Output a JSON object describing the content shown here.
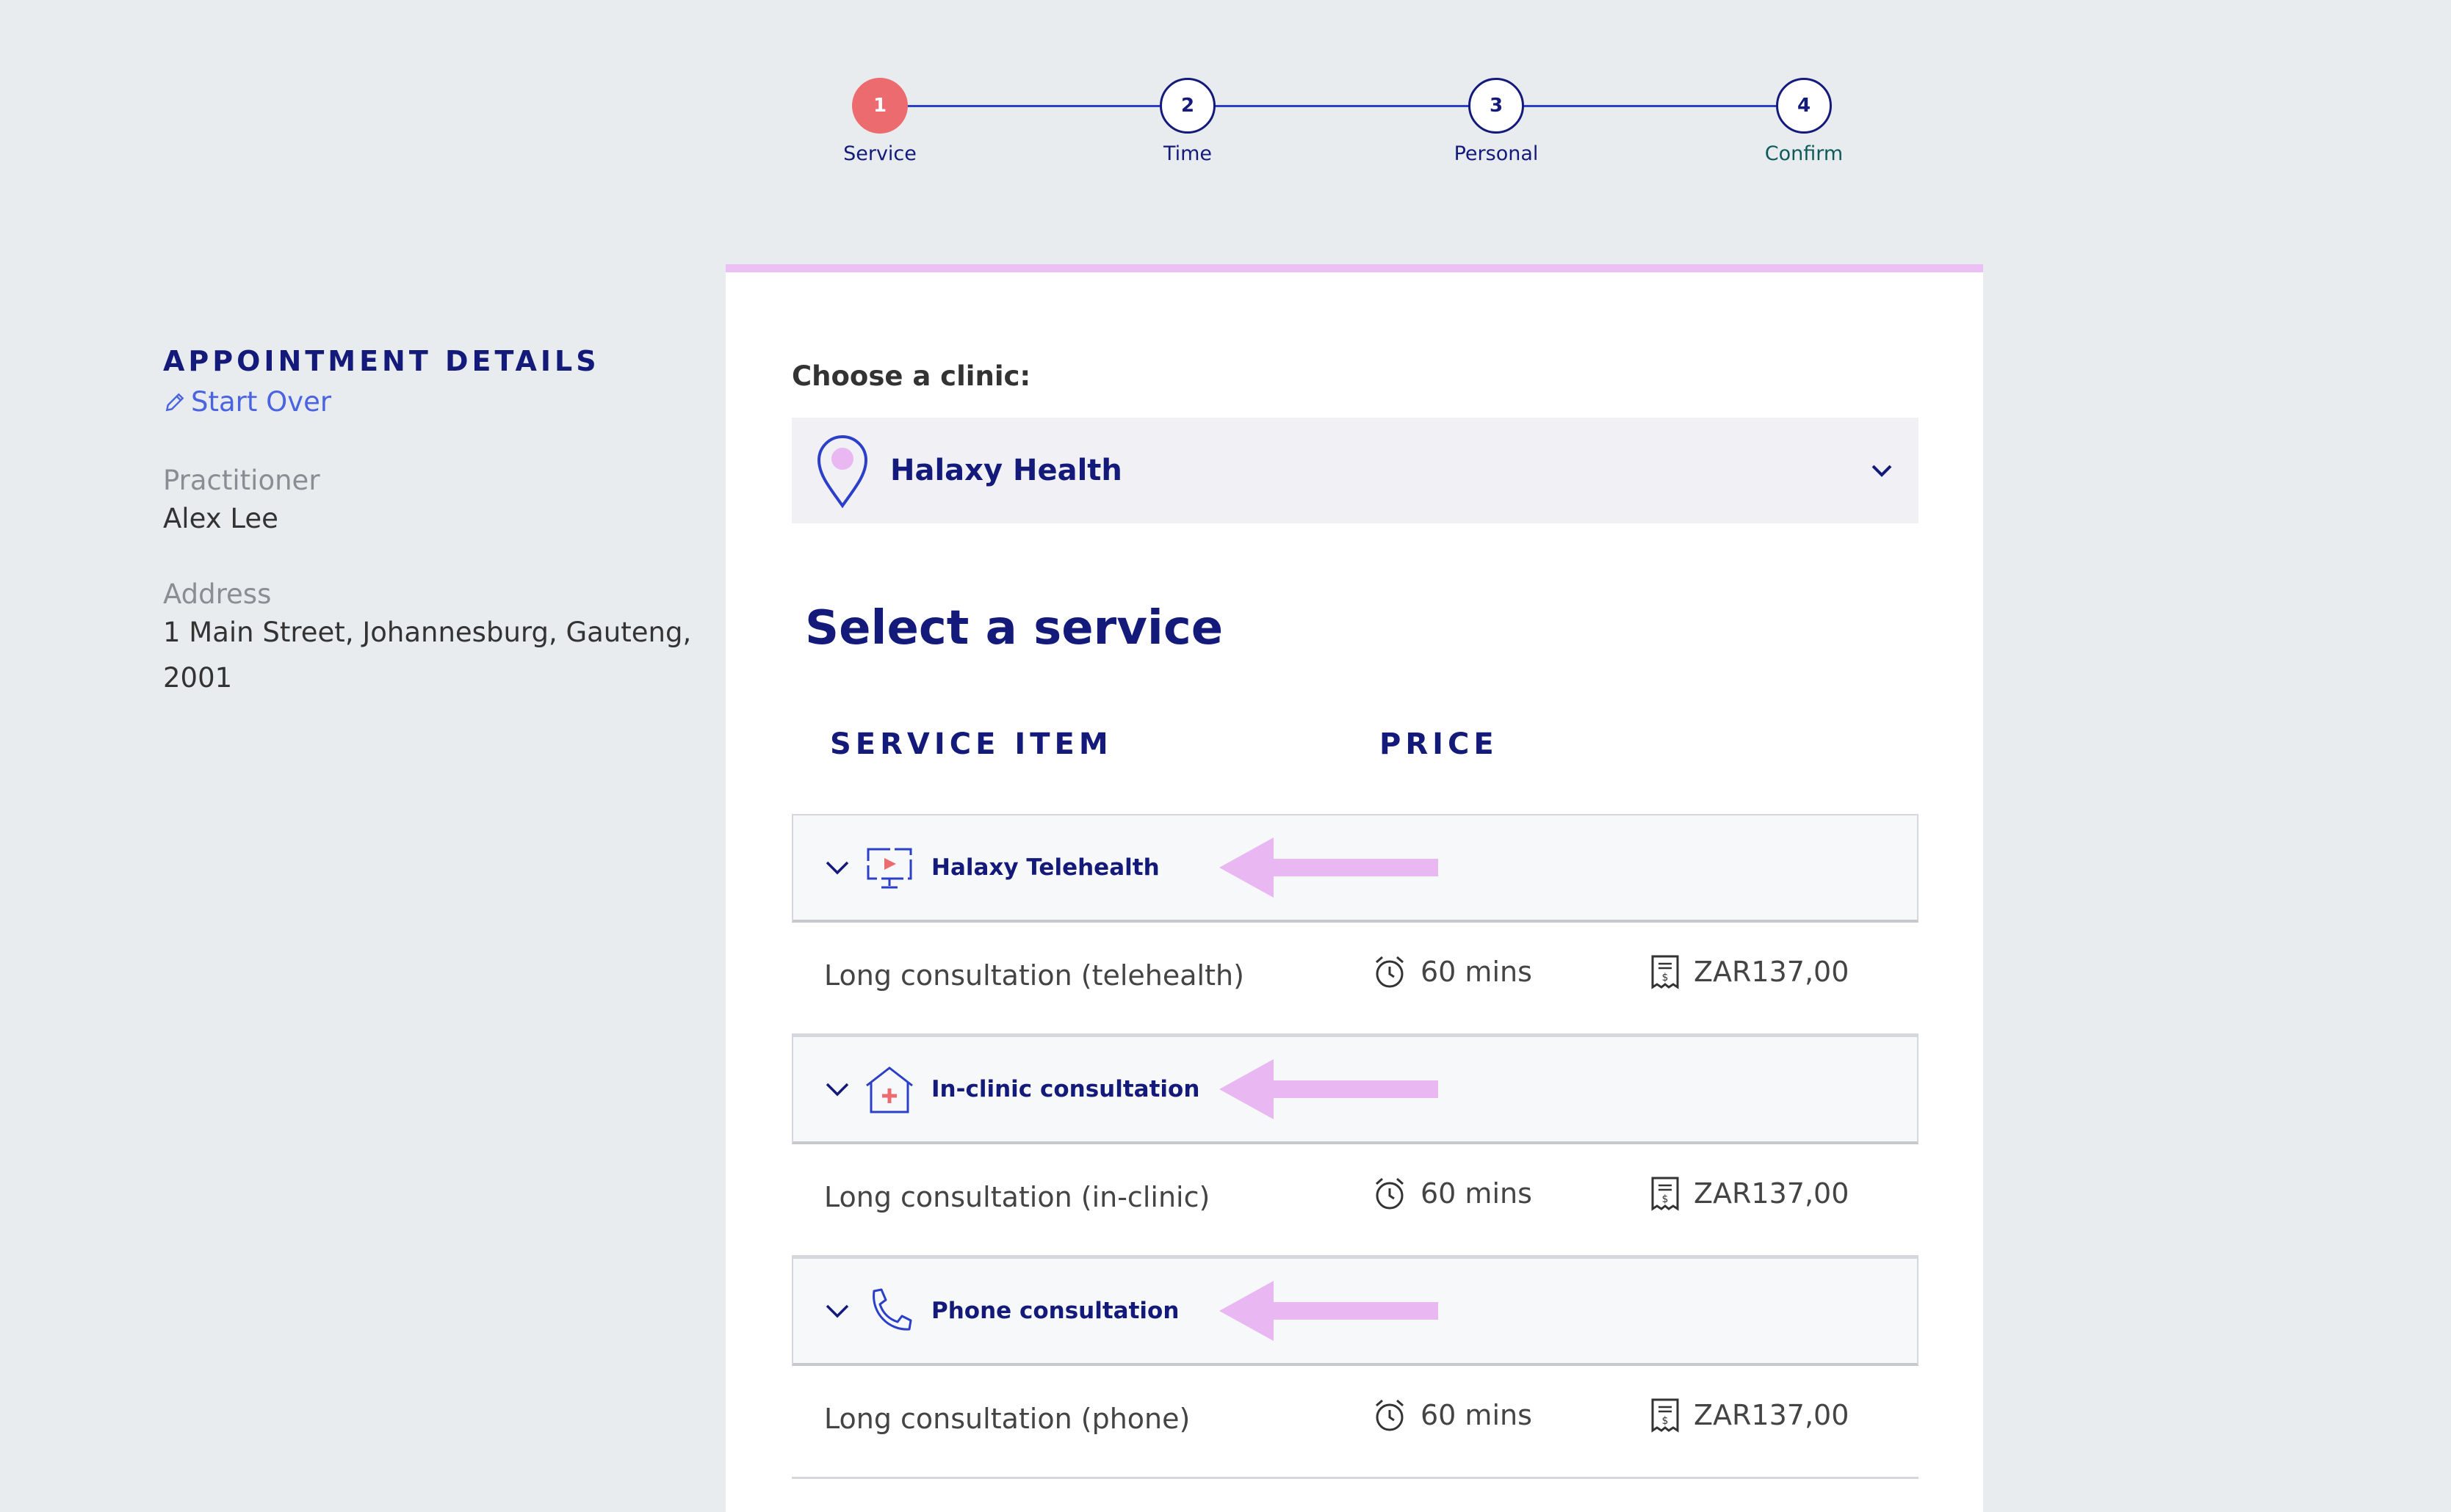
{
  "stepper": {
    "steps": [
      {
        "number": "1",
        "label": "Service"
      },
      {
        "number": "2",
        "label": "Time"
      },
      {
        "number": "3",
        "label": "Personal"
      },
      {
        "number": "4",
        "label": "Confirm"
      }
    ],
    "active_step": 1
  },
  "sidebar": {
    "title": "APPOINTMENT DETAILS",
    "start_over": "Start Over",
    "practitioner_label": "Practitioner",
    "practitioner_value": "Alex Lee",
    "address_label": "Address",
    "address_line1": "1 Main Street, Johannesburg, Gauteng,",
    "address_line2": "2001"
  },
  "clinic": {
    "label": "Choose a clinic:",
    "selected": "Halaxy Health"
  },
  "services": {
    "title": "Select a service",
    "col_service": "SERVICE ITEM",
    "col_price": "PRICE",
    "groups": [
      {
        "label": "Halaxy Telehealth",
        "icon": "telehealth-monitor-icon",
        "item": {
          "name": "Long consultation (telehealth)",
          "duration": "60 mins",
          "price": "ZAR137,00"
        }
      },
      {
        "label": "In-clinic consultation",
        "icon": "clinic-house-cross-icon",
        "item": {
          "name": "Long consultation (in-clinic)",
          "duration": "60 mins",
          "price": "ZAR137,00"
        }
      },
      {
        "label": "Phone consultation",
        "icon": "phone-icon",
        "item": {
          "name": "Long consultation (phone)",
          "duration": "60 mins",
          "price": "ZAR137,00"
        }
      }
    ]
  },
  "colors": {
    "navy": "#141a7a",
    "accent_red": "#ec6b6e",
    "link_blue": "#4a63e0",
    "annotation_pink": "#e9b8f2"
  }
}
